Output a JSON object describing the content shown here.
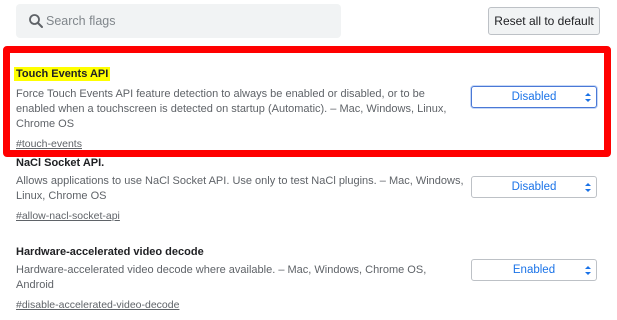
{
  "search": {
    "placeholder": "Search flags",
    "value": ""
  },
  "toolbar": {
    "reset_label": "Reset all to default"
  },
  "experiments": [
    {
      "title": "Touch Events API",
      "description": "Force Touch Events API feature detection to always be enabled or disabled, or to be enabled when a touchscreen is detected on startup (Automatic). – Mac, Windows, Linux, Chrome OS",
      "link": "#touch-events",
      "selected": "Disabled"
    },
    {
      "title": "NaCl Socket API.",
      "description": "Allows applications to use NaCl Socket API. Use only to test NaCl plugins. – Mac, Windows, Linux, Chrome OS",
      "link": "#allow-nacl-socket-api",
      "selected": "Disabled"
    },
    {
      "title": "Hardware-accelerated video decode",
      "description": "Hardware-accelerated video decode where available. – Mac, Windows, Chrome OS, Android",
      "link": "#disable-accelerated-video-decode",
      "selected": "Enabled"
    }
  ],
  "colors": {
    "highlight_frame": "#ff0000",
    "title_highlight": "#ffff00",
    "select_text": "#1a73e8"
  },
  "icons": {
    "search": "search-icon",
    "select_arrows": "chevron-up-down-icon"
  }
}
